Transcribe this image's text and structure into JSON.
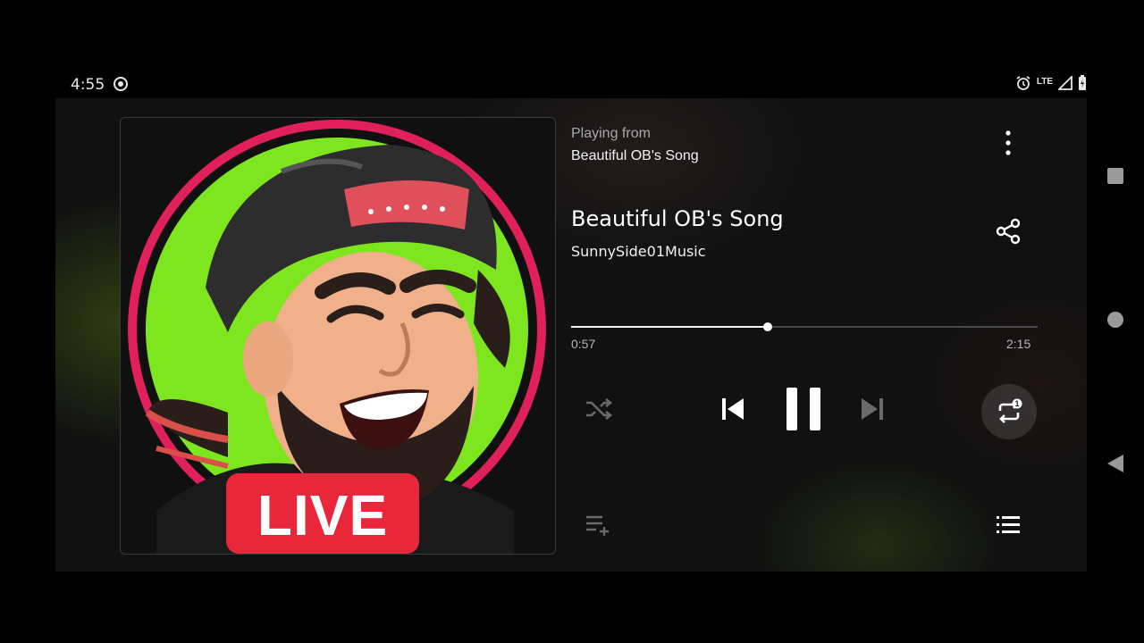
{
  "status_bar": {
    "time": "4:55",
    "network": "LTE",
    "icons": [
      "screen-record-icon",
      "alarm-icon",
      "signal-icon",
      "battery-charging-icon"
    ]
  },
  "player": {
    "playing_from_label": "Playing from",
    "playlist_name": "Beautiful OB's Song",
    "song_title": "Beautiful OB's Song",
    "artist": "SunnySide01Music",
    "elapsed": "0:57",
    "total": "2:15",
    "progress_fraction": 0.422,
    "repeat_mode_badge": "1",
    "artwork_badge": "LIVE",
    "icons": {
      "more": "more-vert-icon",
      "share": "share-icon",
      "shuffle": "shuffle-icon",
      "previous": "skip-previous-icon",
      "pause": "pause-icon",
      "next": "skip-next-icon",
      "repeat": "repeat-one-icon",
      "add_to_queue": "playlist-add-icon",
      "queue": "queue-list-icon"
    }
  },
  "nav_bar": {
    "icons": [
      "recents-icon",
      "home-icon",
      "back-icon"
    ]
  },
  "colors": {
    "background": "#000000",
    "player_bg": "#111111",
    "text_primary": "#ffffff",
    "text_secondary": "#a9a9a9",
    "progress_track": "#4a4a4a",
    "art_green": "#7ee61e",
    "art_ring": "#e0205a",
    "live_red": "#e8283a"
  }
}
